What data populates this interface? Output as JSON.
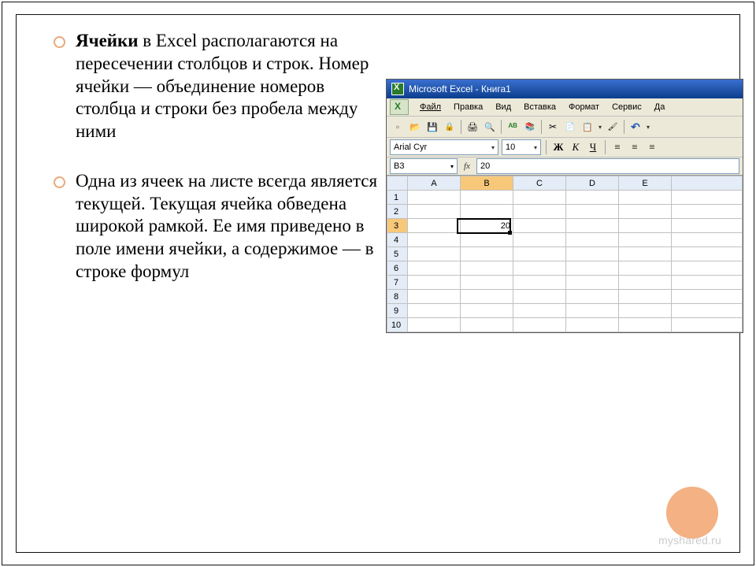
{
  "slide": {
    "bullets": [
      {
        "bold": "Ячейки",
        "text": " в Excel располагаются на пересечении столбцов и строк. Номер ячейки — объединение номеров столбца и строки без пробела между ними"
      },
      {
        "bold": "",
        "text": "Одна из ячеек на листе всегда является текущей. Текущая ячейка обведена широкой рамкой. Ее имя приведено в поле имени ячейки, а содержимое — в строке формул"
      }
    ]
  },
  "watermark": "myshared.ru",
  "excel": {
    "title": "Microsoft Excel - Книга1",
    "menus": [
      "Файл",
      "Правка",
      "Вид",
      "Вставка",
      "Формат",
      "Сервис",
      "Да"
    ],
    "font_name": "Arial Cyr",
    "font_size": "10",
    "bold_btn": "Ж",
    "italic_btn": "К",
    "underline_btn": "Ч",
    "namebox": "B3",
    "fx_label": "fx",
    "formula_value": "20",
    "columns": [
      "A",
      "B",
      "C",
      "D",
      "E"
    ],
    "rows": [
      "1",
      "2",
      "3",
      "4",
      "5",
      "6",
      "7",
      "8",
      "9",
      "10"
    ],
    "selected_cell_value": "20",
    "selected_row": 3,
    "selected_col": "B"
  }
}
